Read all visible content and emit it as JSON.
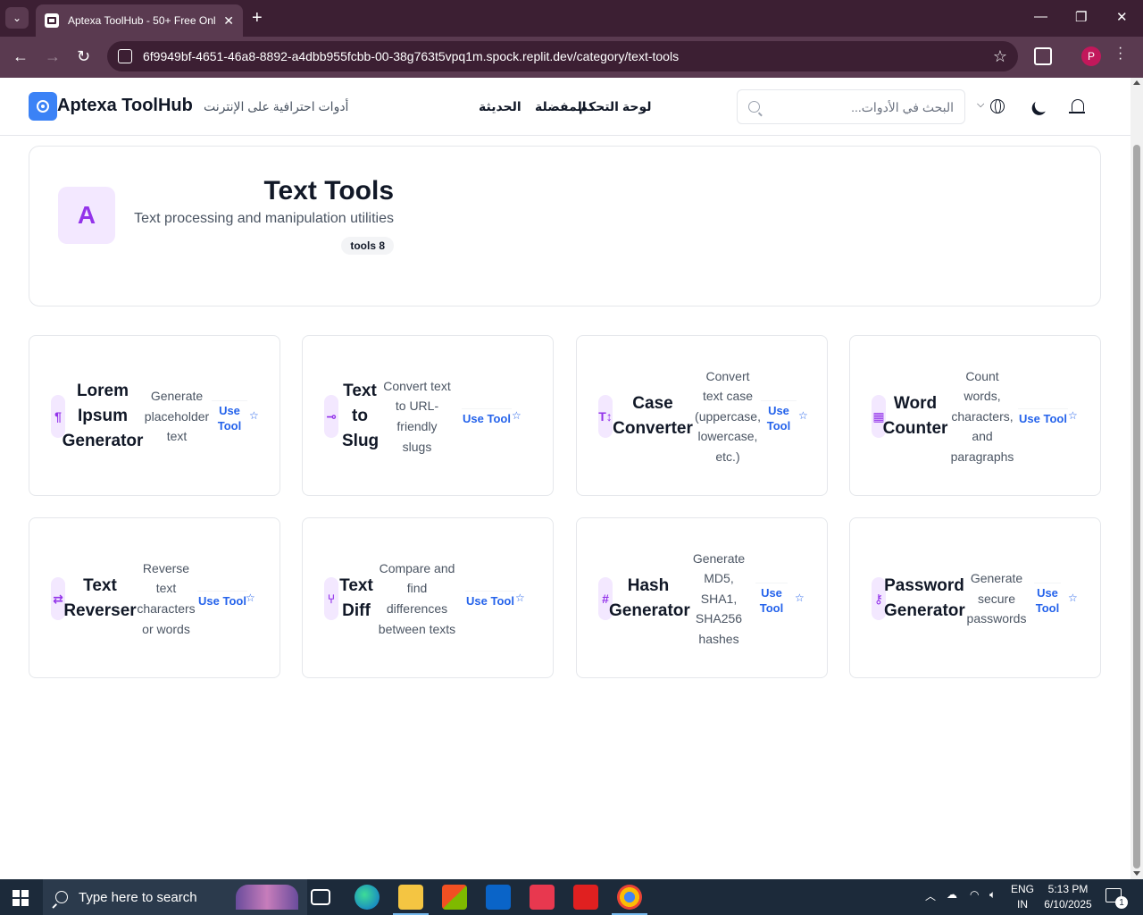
{
  "browser": {
    "tab_title": "Aptexa ToolHub - 50+ Free Onl",
    "url": "6f9949bf-4651-46a8-8892-a4dbb955fcbb-00-38g763t5vpq1m.spock.replit.dev/category/text-tools",
    "profile_initial": "P"
  },
  "header": {
    "brand": "Aptexa ToolHub",
    "tagline": "أدوات احترافية على الإنترنت",
    "nav": [
      "الحديثة",
      "المفضلة",
      "لوحة التحكم"
    ],
    "search_placeholder": "البحث في الأدوات..."
  },
  "category": {
    "icon_letter": "A",
    "title": "Text Tools",
    "description": "Text processing and manipulation utilities",
    "badge": "tools 8"
  },
  "tools": [
    {
      "name_lines": [
        "Lorem",
        "Ipsum",
        "Generator"
      ],
      "desc_lines": [
        "Generate",
        "placeholder",
        "text"
      ],
      "use_lines": [
        "Use",
        "Tool"
      ],
      "icon": "pilcrow-icon",
      "glyph": "¶"
    },
    {
      "name_lines": [
        "Text",
        "to",
        "Slug"
      ],
      "desc_lines": [
        "Convert text",
        "to URL-",
        "friendly",
        "slugs"
      ],
      "use_lines": [
        "Use Tool"
      ],
      "icon": "link-icon",
      "glyph": "⊸"
    },
    {
      "name_lines": [
        "Case",
        "Converter"
      ],
      "desc_lines": [
        "Convert",
        "text case",
        "(uppercase,",
        "lowercase,",
        "etc.)"
      ],
      "use_lines": [
        "Use",
        "Tool"
      ],
      "icon": "text-case-icon",
      "glyph": "T↕"
    },
    {
      "name_lines": [
        "Word",
        "Counter"
      ],
      "desc_lines": [
        "Count",
        "words,",
        "characters,",
        "and",
        "paragraphs"
      ],
      "use_lines": [
        "Use Tool"
      ],
      "icon": "calculator-icon",
      "glyph": "▦"
    },
    {
      "name_lines": [
        "Text",
        "Reverser"
      ],
      "desc_lines": [
        "Reverse",
        "text",
        "characters",
        "or words"
      ],
      "use_lines": [
        "Use Tool"
      ],
      "icon": "arrows-swap-icon",
      "glyph": "⇄"
    },
    {
      "name_lines": [
        "Text",
        "Diff"
      ],
      "desc_lines": [
        "Compare and",
        "find",
        "differences",
        "between texts"
      ],
      "use_lines": [
        "Use Tool"
      ],
      "icon": "git-branch-icon",
      "glyph": "⑂"
    },
    {
      "name_lines": [
        "Hash",
        "Generator"
      ],
      "desc_lines": [
        "Generate",
        "MD5,",
        "SHA1,",
        "SHA256",
        "hashes"
      ],
      "use_lines": [
        "Use",
        "Tool"
      ],
      "icon": "hash-icon",
      "glyph": "#"
    },
    {
      "name_lines": [
        "Password",
        "Generator"
      ],
      "desc_lines": [
        "Generate",
        "secure",
        "passwords"
      ],
      "use_lines": [
        "Use",
        "Tool"
      ],
      "icon": "key-icon",
      "glyph": "⚷"
    }
  ],
  "taskbar": {
    "search_placeholder": "Type here to search",
    "lang_top": "ENG",
    "lang_bottom": "IN",
    "time": "5:13 PM",
    "date": "6/10/2025",
    "notification_count": "1"
  },
  "colors": {
    "accent": "#9333ea",
    "link": "#2563eb",
    "chrome": "#3c1f33"
  }
}
